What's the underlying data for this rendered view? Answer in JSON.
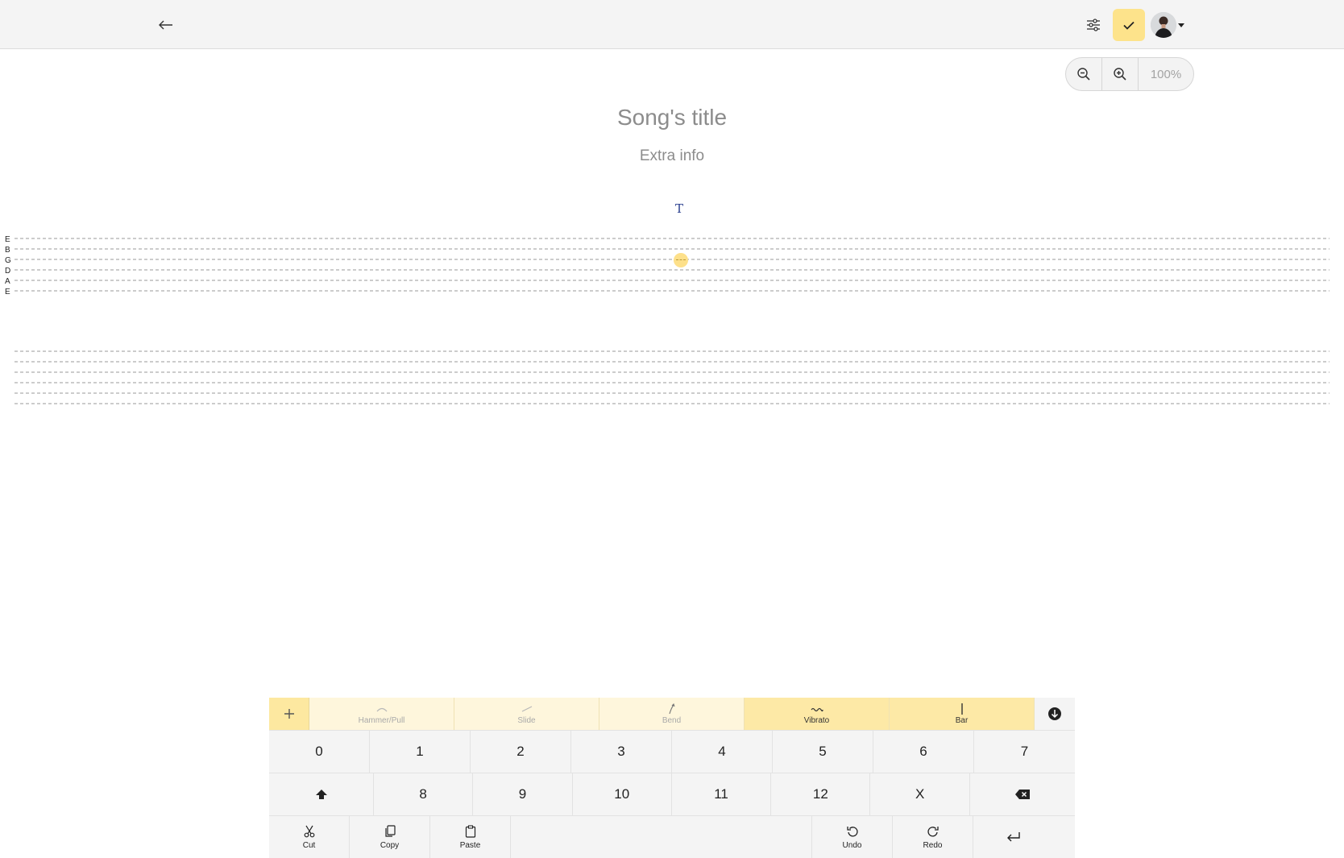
{
  "header": {
    "back_icon": "arrow-left-icon",
    "settings_icon": "sliders-icon",
    "confirm_icon": "check-icon",
    "accent": "#fde38b"
  },
  "zoom": {
    "zoom_out_icon": "zoom-out-icon",
    "zoom_in_icon": "zoom-in-icon",
    "level": "100%"
  },
  "song": {
    "title_placeholder": "Song's title",
    "extra_placeholder": "Extra info",
    "tab_marker": "T"
  },
  "staff": {
    "strings": [
      "E",
      "B",
      "G",
      "D",
      "A",
      "E"
    ]
  },
  "keyboard": {
    "add_icon": "plus-icon",
    "effects": [
      {
        "label": "Hammer/Pull",
        "icon": "arc-icon",
        "state": "inactive"
      },
      {
        "label": "Slide",
        "icon": "slide-icon",
        "state": "inactive"
      },
      {
        "label": "Bend",
        "icon": "bend-icon",
        "state": "inactive"
      },
      {
        "label": "Vibrato",
        "icon": "wave-icon",
        "state": "active"
      },
      {
        "label": "Bar",
        "icon": "bar-icon",
        "state": "active"
      }
    ],
    "collapse_icon": "arrow-down-circle-icon",
    "row1": [
      "0",
      "1",
      "2",
      "3",
      "4",
      "5",
      "6",
      "7"
    ],
    "row2": [
      "8",
      "9",
      "10",
      "11",
      "12",
      "X"
    ],
    "tools": {
      "cut": "Cut",
      "copy": "Copy",
      "paste": "Paste",
      "undo": "Undo",
      "redo": "Redo"
    }
  }
}
